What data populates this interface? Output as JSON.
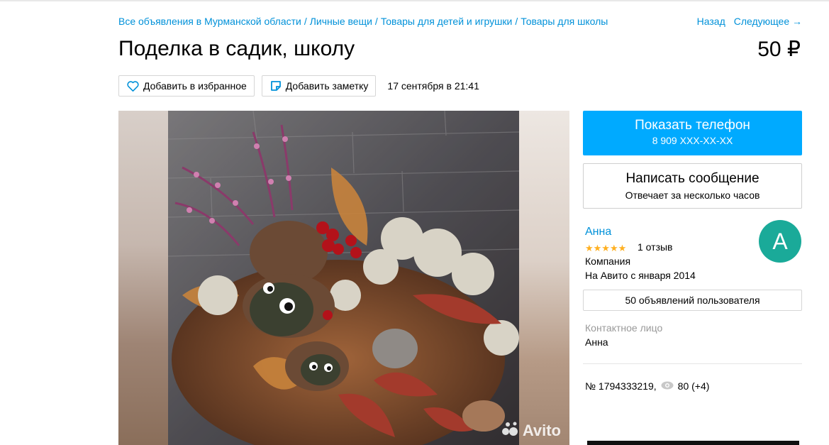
{
  "breadcrumb": {
    "items": [
      "Все объявления в Мурманской области",
      "Личные вещи",
      "Товары для детей и игрушки",
      "Товары для школы"
    ],
    "separator": "/"
  },
  "nav": {
    "back": "Назад",
    "next": "Следующее →"
  },
  "item": {
    "title": "Поделка в садик, школу",
    "price": "50 ₽",
    "date": "17 сентября в 21:41"
  },
  "actions": {
    "favorite": "Добавить в избранное",
    "note": "Добавить заметку"
  },
  "gallery": {
    "watermark": "Avito"
  },
  "sidebar": {
    "phone_button": {
      "label": "Показать телефон",
      "number": "8 909 XXX-XX-XX"
    },
    "message_button": {
      "label": "Написать сообщение",
      "sub": "Отвечает за несколько часов"
    },
    "seller": {
      "name": "Анна",
      "stars": "★★★★★",
      "rating": 5,
      "reviews": "1 отзыв",
      "type": "Компания",
      "since": "На Авито с января 2014",
      "avatar_letter": "А"
    },
    "ads_button": "50 объявлений пользователя",
    "contact_label": "Контактное лицо",
    "contact_name": "Анна",
    "ad_number": "№ 1794333219,",
    "views": "80 (+4)"
  },
  "colors": {
    "link": "#0091d9",
    "primary_button": "#00aaff",
    "avatar": "#1aaa99",
    "stars": "#ffb021"
  }
}
